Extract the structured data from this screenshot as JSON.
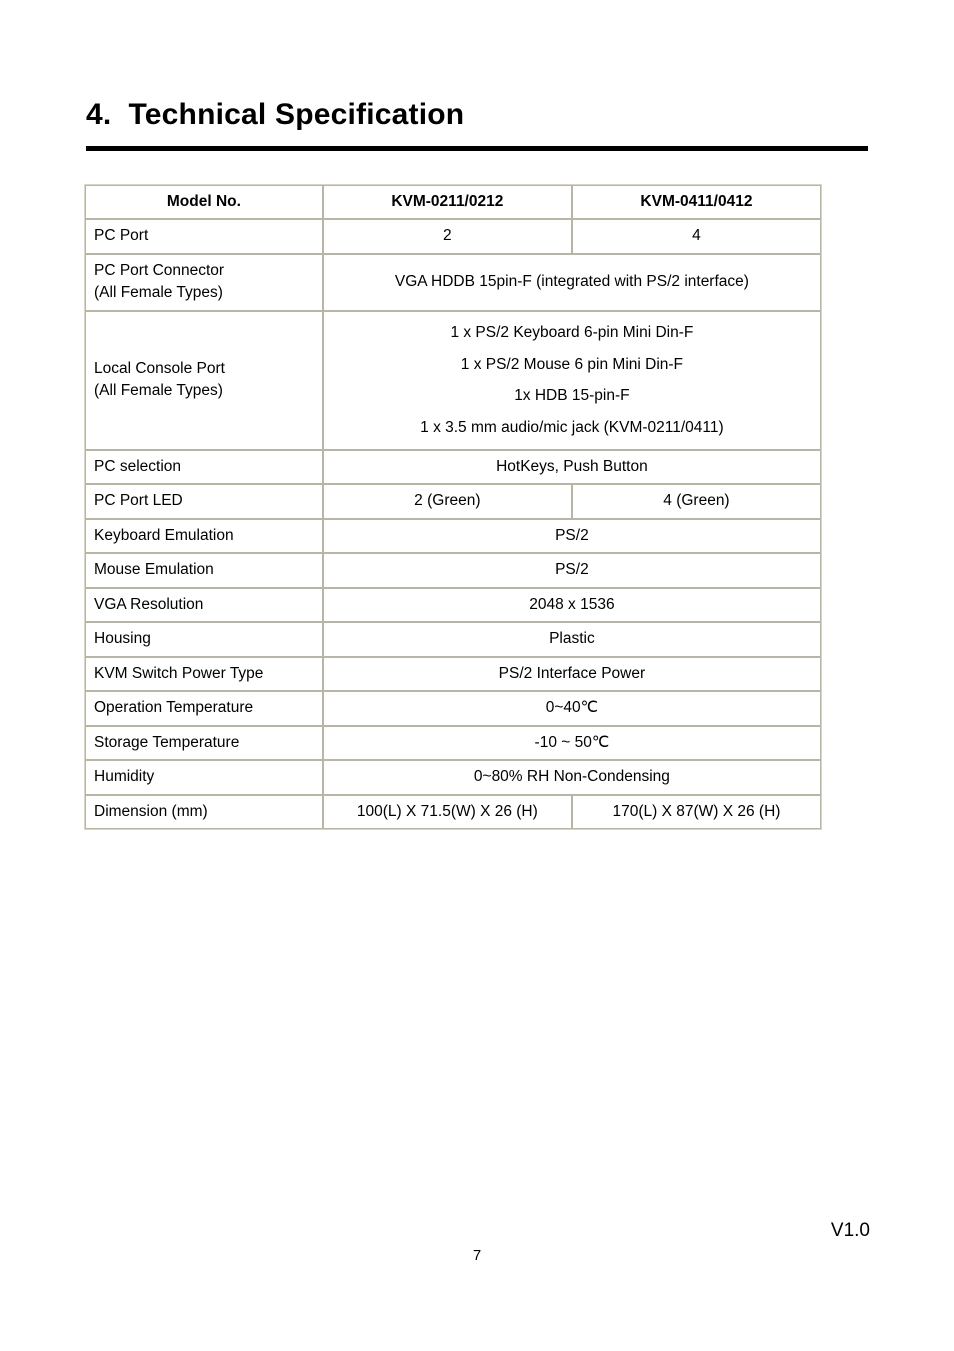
{
  "document": {
    "heading": "4.  Technical Specification",
    "version": "V1.0",
    "page_number": "7"
  },
  "spec_table": {
    "headers": {
      "label": "Model No.",
      "col1": "KVM-0211/0212",
      "col2": "KVM-0411/0412"
    },
    "rows": [
      {
        "label": "PC Port",
        "type": "split",
        "col1": "2",
        "col2": "4"
      },
      {
        "label": "PC Port Connector\n(All Female Types)",
        "type": "merged",
        "value": "VGA HDDB 15pin-F (integrated with PS/2 interface)"
      },
      {
        "label": "Local Console Port\n(All Female Types)",
        "type": "merged",
        "value": "1 x PS/2 Keyboard 6-pin Mini Din-F\n1 x PS/2 Mouse 6 pin Mini Din-F\n1x HDB 15-pin-F\n1 x 3.5 mm audio/mic jack (KVM-0211/0411)"
      },
      {
        "label": "PC selection",
        "type": "merged",
        "value": "HotKeys, Push Button"
      },
      {
        "label": "PC Port LED",
        "type": "split",
        "col1": "2 (Green)",
        "col2": "4 (Green)"
      },
      {
        "label": "Keyboard Emulation",
        "type": "merged",
        "value": "PS/2"
      },
      {
        "label": "Mouse Emulation",
        "type": "merged",
        "value": "PS/2"
      },
      {
        "label": "VGA Resolution",
        "type": "merged",
        "value": "2048 x 1536"
      },
      {
        "label": "Housing",
        "type": "merged",
        "value": "Plastic"
      },
      {
        "label": "KVM Switch Power Type",
        "type": "merged",
        "value": "PS/2 Interface Power"
      },
      {
        "label": "Operation Temperature",
        "type": "merged",
        "value": "0~40℃"
      },
      {
        "label": "Storage Temperature",
        "type": "merged",
        "value": "-10 ~ 50℃"
      },
      {
        "label": "Humidity",
        "type": "merged",
        "value": "0~80% RH Non-Condensing"
      },
      {
        "label": "Dimension (mm)",
        "type": "split",
        "col1": "100(L) X 71.5(W) X 26 (H)",
        "col2": "170(L) X 87(W) X 26 (H)"
      }
    ]
  }
}
